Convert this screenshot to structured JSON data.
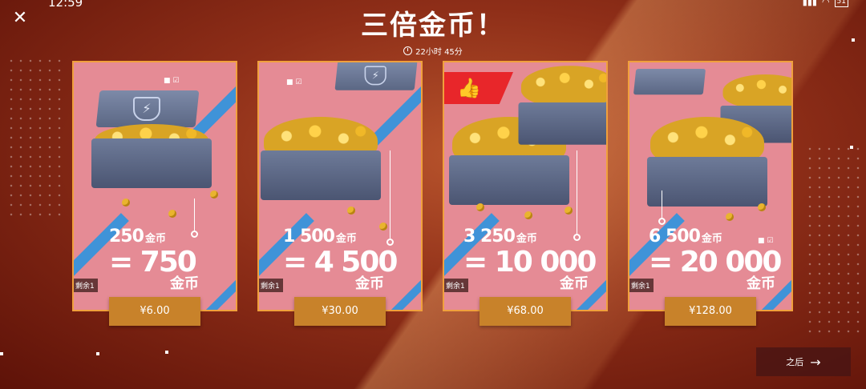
{
  "status_bar": {
    "time": "12:59",
    "battery": "51"
  },
  "header": {
    "title": "三倍金币！",
    "timer": "22小时 45分"
  },
  "cards": [
    {
      "base": "250",
      "base_unit": "金币",
      "total": "= 750",
      "total_unit": "金币",
      "remaining": "剩余1",
      "price": "¥6.00",
      "featured": false
    },
    {
      "base": "1 500",
      "base_unit": "金币",
      "total": "= 4 500",
      "total_unit": "金币",
      "remaining": "剩余1",
      "price": "¥30.00",
      "featured": false
    },
    {
      "base": "3 250",
      "base_unit": "金币",
      "total": "= 10 000",
      "total_unit": "金币",
      "remaining": "剩余1",
      "price": "¥68.00",
      "featured": true
    },
    {
      "base": "6 500",
      "base_unit": "金币",
      "total": "= 20 000",
      "total_unit": "金币",
      "remaining": "剩余1",
      "price": "¥128.00",
      "featured": false
    }
  ],
  "footer": {
    "next_label": "之后"
  },
  "colors": {
    "accent": "#c8822a",
    "card": "#e58b95",
    "stripe": "#3f93d8",
    "badge": "#e8262a"
  }
}
